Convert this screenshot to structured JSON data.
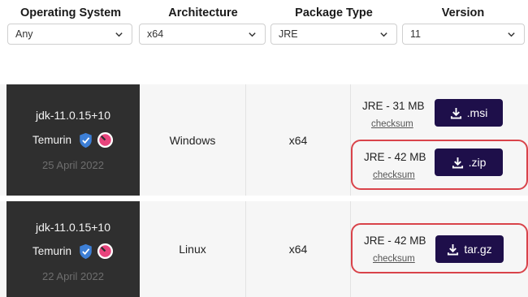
{
  "filters": [
    {
      "label": "Operating System",
      "value": "Any"
    },
    {
      "label": "Architecture",
      "value": "x64"
    },
    {
      "label": "Package Type",
      "value": "JRE"
    },
    {
      "label": "Version",
      "value": "11"
    }
  ],
  "releases": [
    {
      "name": "jdk-11.0.15+10",
      "vendor": "Temurin",
      "date": "25 April 2022",
      "os": "Windows",
      "arch": "x64",
      "packages": [
        {
          "size": "JRE - 31 MB",
          "checksum": "checksum",
          "button": ".msi",
          "highlighted": false
        },
        {
          "size": "JRE - 42 MB",
          "checksum": "checksum",
          "button": ".zip",
          "highlighted": true
        }
      ]
    },
    {
      "name": "jdk-11.0.15+10",
      "vendor": "Temurin",
      "date": "22 April 2022",
      "os": "Linux",
      "arch": "x64",
      "packages": [
        {
          "size": "JRE - 42 MB",
          "checksum": "checksum",
          "button": "tar.gz",
          "highlighted": true
        }
      ]
    }
  ],
  "icons": {
    "verified": "shield-check-icon",
    "vendor_logo": "temurin-logo-icon",
    "download": "download-icon",
    "dropdown": "chevron-down-icon"
  },
  "colors": {
    "button_bg": "#1e0f4a",
    "highlight_border": "#d9434a",
    "version_cell_bg": "#2f2f2f",
    "shield": "#3d7fd6",
    "logo_pink": "#e8447d"
  }
}
